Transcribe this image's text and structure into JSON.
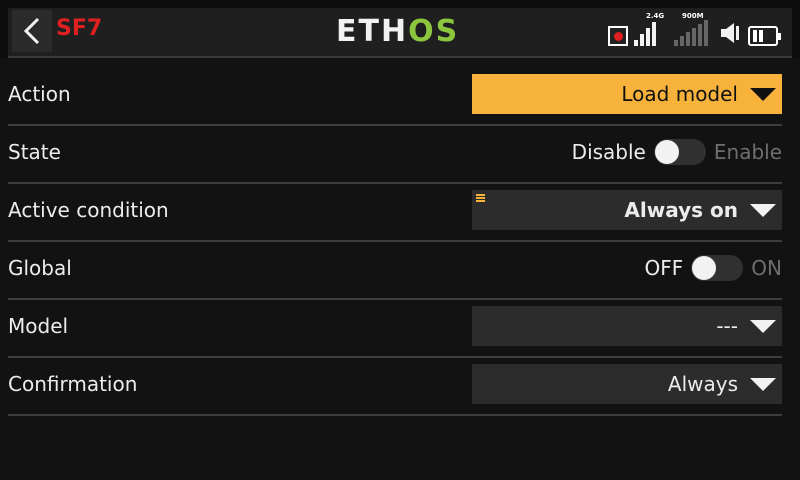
{
  "header": {
    "title": "SF7",
    "logo_left": "ETH",
    "logo_right": "OS",
    "back_icon": "chevron-left-icon",
    "status": {
      "record_icon": "record-icon",
      "signal_24_label": "2.4G",
      "signal_900_label": "900M",
      "speaker_icon": "speaker-muted-icon",
      "battery_icon": "battery-icon"
    }
  },
  "rows": {
    "action": {
      "label": "Action",
      "value": "Load model"
    },
    "state": {
      "label": "State",
      "off_label": "Disable",
      "on_label": "Enable",
      "enabled": false
    },
    "active_condition": {
      "label": "Active condition",
      "value": "Always on"
    },
    "global": {
      "label": "Global",
      "off_label": "OFF",
      "on_label": "ON",
      "enabled": false
    },
    "model": {
      "label": "Model",
      "value": "---"
    },
    "confirmation": {
      "label": "Confirmation",
      "value": "Always"
    }
  },
  "colors": {
    "accent": "#f7b23b",
    "title_red": "#e02020",
    "logo_green": "#8cc63f",
    "background": "#121212"
  }
}
